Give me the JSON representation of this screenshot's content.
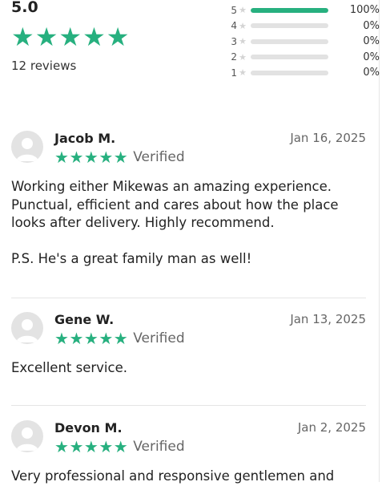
{
  "summary": {
    "average": "5.0",
    "review_count": "12 reviews",
    "distribution": [
      {
        "stars": "5",
        "percent": "100%",
        "fraction": 1.0
      },
      {
        "stars": "4",
        "percent": "0%",
        "fraction": 0
      },
      {
        "stars": "3",
        "percent": "0%",
        "fraction": 0
      },
      {
        "stars": "2",
        "percent": "0%",
        "fraction": 0
      },
      {
        "stars": "1",
        "percent": "0%",
        "fraction": 0
      }
    ]
  },
  "reviews": [
    {
      "name": "Jacob M.",
      "date": "Jan 16, 2025",
      "rating": 5,
      "verified": "Verified",
      "text": "Working either Mikewas an amazing experience. Punctual, efficient and cares about how the place looks after delivery. Highly recommend.",
      "text2": "P.S. He's a great family man as well!"
    },
    {
      "name": "Gene W.",
      "date": "Jan 13, 2025",
      "rating": 5,
      "verified": "Verified",
      "text": "Excellent service."
    },
    {
      "name": "Devon M.",
      "date": "Jan 2, 2025",
      "rating": 5,
      "verified": "Verified",
      "text": "Very professional and responsive gentlemen and"
    }
  ],
  "colors": {
    "accent": "#27b07f",
    "track": "#e2e2e2",
    "muted": "#666666"
  },
  "icons": {
    "star": "star-icon",
    "avatar": "user-avatar-icon"
  }
}
